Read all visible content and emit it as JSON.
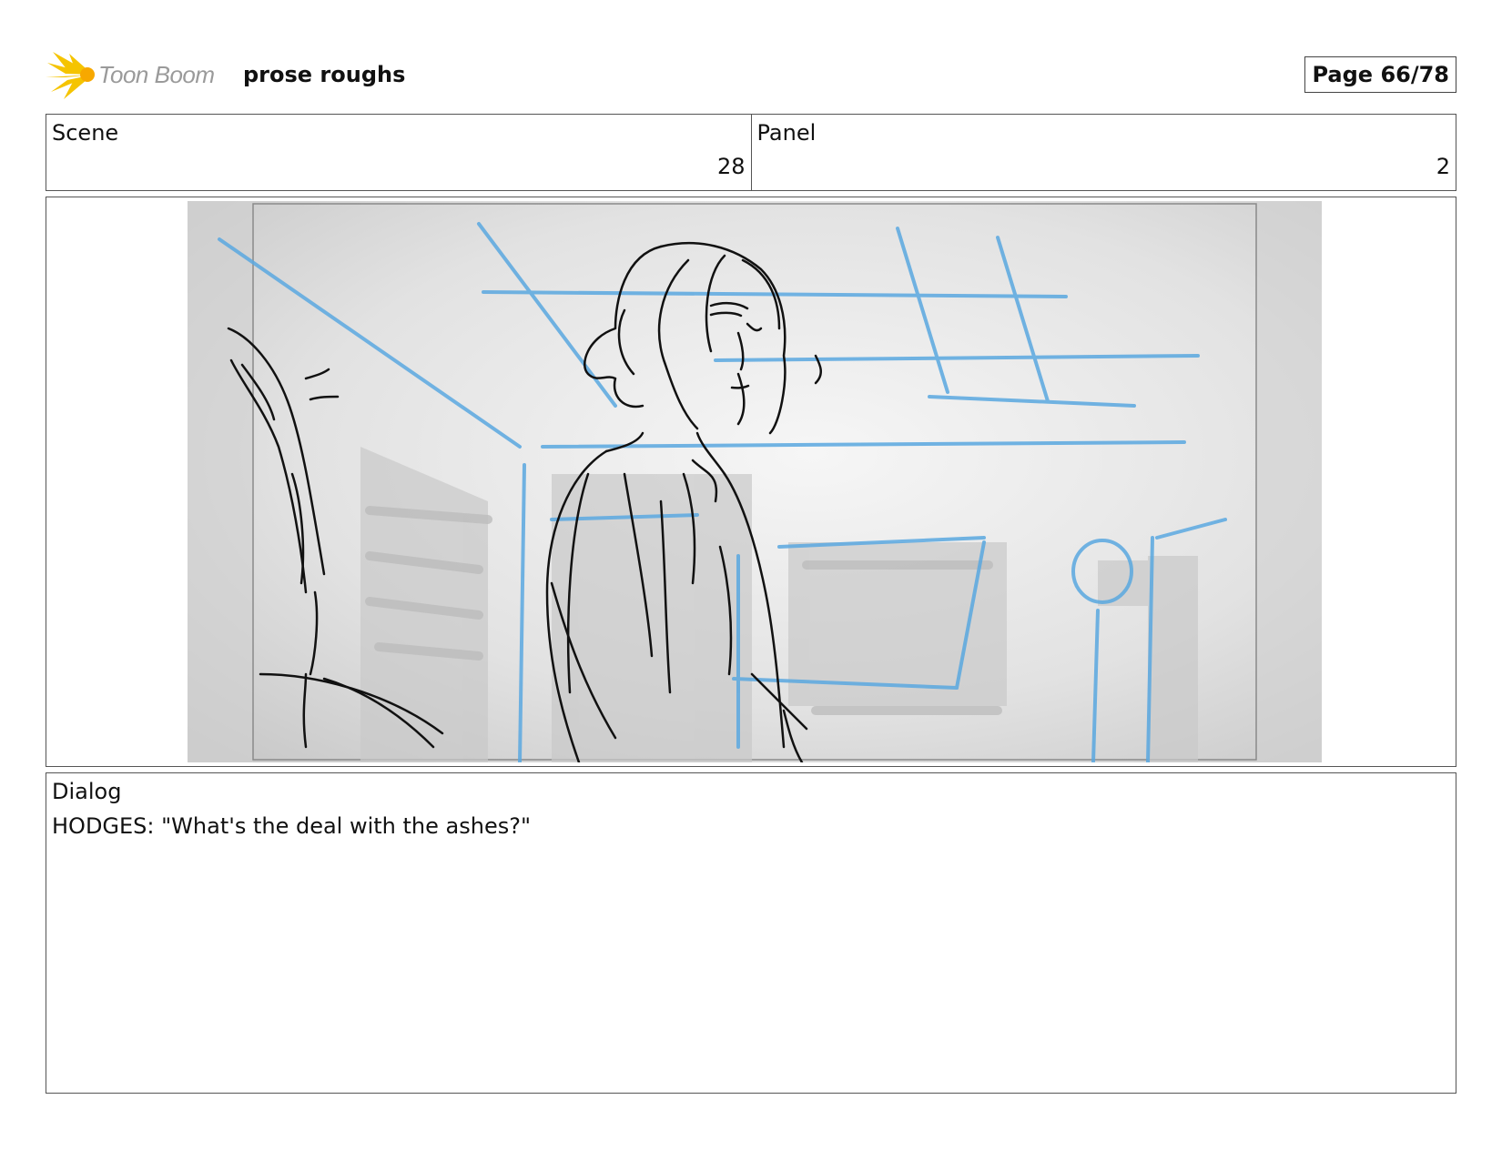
{
  "header": {
    "logo_text": "Toon Boom",
    "project_title": "prose roughs",
    "page_label": "Page 66/78"
  },
  "scene": {
    "label": "Scene",
    "value": "28"
  },
  "panel": {
    "label": "Panel",
    "value": "2"
  },
  "image": {
    "description_icon": "storyboard-sketch-image",
    "colors": {
      "pencil": "#111111",
      "layout_blue": "#5aa8e0",
      "shading": "#d9d9d9"
    }
  },
  "dialog": {
    "label": "Dialog",
    "text": "HODGES: \"What's the deal with the ashes?\""
  }
}
